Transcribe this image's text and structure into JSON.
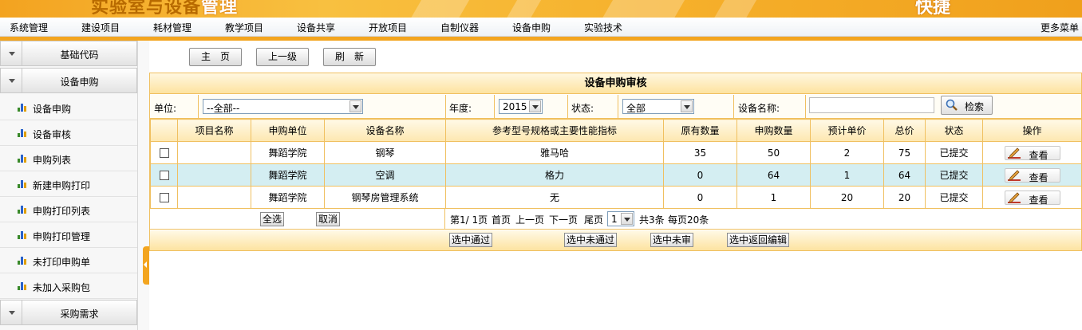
{
  "banner": {
    "title_main": "实验室与设备",
    "title_highlight": "管理",
    "title_right": "快捷"
  },
  "menu": {
    "items": [
      "系统管理",
      "建设项目",
      "耗材管理",
      "教学项目",
      "设备共享",
      "开放项目",
      "自制仪器",
      "设备申购",
      "实验技术"
    ],
    "more": "更多菜单"
  },
  "sidebar": {
    "group1": "基础代码",
    "group2": "设备申购",
    "items": [
      "设备申购",
      "设备审核",
      "申购列表",
      "新建申购打印",
      "申购打印列表",
      "申购打印管理",
      "未打印申购单",
      "未加入采购包"
    ],
    "group3": "采购需求"
  },
  "toolbar": {
    "home": "主　页",
    "up": "上一级",
    "refresh": "刷　新"
  },
  "panel": {
    "title": "设备申购审核",
    "filter": {
      "unit_label": "单位:",
      "unit_value": "--全部--",
      "year_label": "年度:",
      "year_value": "2015",
      "status_label": "状态:",
      "status_value": "全部",
      "name_label": "设备名称:",
      "name_value": "",
      "search_label": "检索"
    },
    "columns": [
      "项目名称",
      "申购单位",
      "设备名称",
      "参考型号规格或主要性能指标",
      "原有数量",
      "申购数量",
      "预计单价",
      "总价",
      "状态",
      "操作"
    ],
    "rows": [
      {
        "project": "",
        "unit": "舞蹈学院",
        "name": "钢琴",
        "spec": "雅马哈",
        "orig": "35",
        "qty": "50",
        "price": "2",
        "total": "75",
        "status": "已提交",
        "action": "查看"
      },
      {
        "project": "",
        "unit": "舞蹈学院",
        "name": "空调",
        "spec": "格力",
        "orig": "0",
        "qty": "64",
        "price": "1",
        "total": "64",
        "status": "已提交",
        "action": "查看"
      },
      {
        "project": "",
        "unit": "舞蹈学院",
        "name": "钢琴房管理系统",
        "spec": "无",
        "orig": "0",
        "qty": "1",
        "price": "20",
        "total": "20",
        "status": "已提交",
        "action": "查看"
      }
    ],
    "select_all": "全选",
    "cancel": "取消",
    "pager": {
      "page_info": "第1/ 1页",
      "first": "首页",
      "prev": "上一页",
      "next": "下一页",
      "last": "尾页",
      "page_value": "1",
      "total": "共3条",
      "per_page": "每页20条"
    },
    "actions": [
      "选中通过",
      "选中未通过",
      "选中未审",
      "选中返回编辑"
    ]
  },
  "colors": {
    "accent": "#f3a51f",
    "highlight_row": "#d4eef2",
    "border": "#f0c060"
  }
}
